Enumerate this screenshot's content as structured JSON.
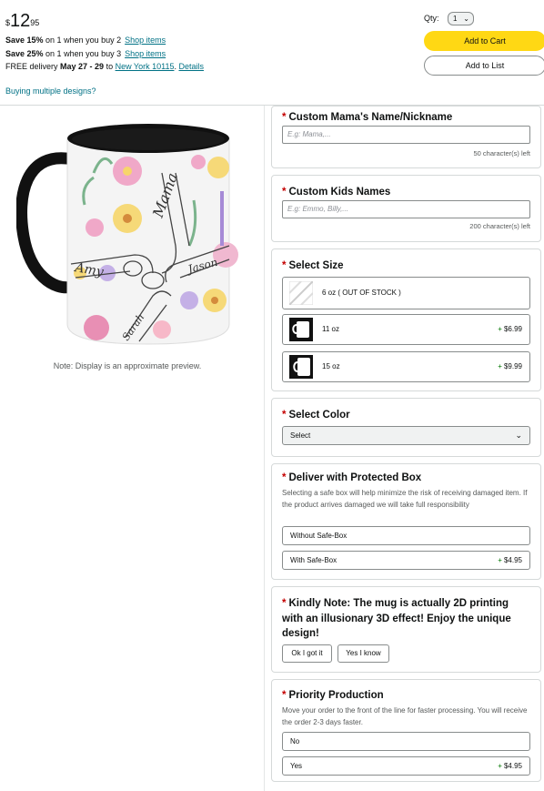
{
  "header": {
    "price_symbol": "$",
    "price_whole": "12",
    "price_fraction": "95",
    "offers": [
      {
        "bold": "Save 15%",
        "text": " on 1 when you buy 2",
        "link": "Shop items"
      },
      {
        "bold": "Save 25%",
        "text": " on 1 when you buy 3",
        "link": "Shop items"
      }
    ],
    "delivery": {
      "prefix": "FREE delivery ",
      "dates": "May 27 - 29",
      "to": " to ",
      "location": "New York 10115",
      "sep": ". ",
      "details": "Details"
    },
    "multi_link": "Buying multiple designs?",
    "qty_label": "Qty:",
    "qty_value": "1",
    "add_to_cart": "Add to Cart",
    "add_to_list": "Add to List"
  },
  "preview": {
    "names": [
      "Mama",
      "Amy",
      "Jason",
      "Sarah"
    ],
    "note": "Note: Display is an approximate preview."
  },
  "mama_name": {
    "title": "Custom Mama's Name/Nickname",
    "placeholder": "E.g: Mama,...",
    "counter": "50 character(s) left"
  },
  "kids_names": {
    "title": "Custom Kids Names",
    "placeholder": "E.g: Emmo, Billy,...",
    "counter": "200 character(s) left"
  },
  "size": {
    "title": "Select Size",
    "options": [
      {
        "label": "6 oz ( OUT OF STOCK )",
        "price": ""
      },
      {
        "label": "11 oz",
        "price": "$6.99"
      },
      {
        "label": "15 oz",
        "price": "$9.99"
      }
    ]
  },
  "color": {
    "title": "Select Color",
    "selected": "Select"
  },
  "protected_box": {
    "title": "Deliver with Protected Box",
    "description": "Selecting a safe box will help minimize the risk of receiving damaged item. If the product arrives damaged we will take full responsibility",
    "options": [
      {
        "label": "Without Safe-Box",
        "price": ""
      },
      {
        "label": "With Safe-Box",
        "price": "$4.95"
      }
    ]
  },
  "kindly_note": {
    "title": "Kindly Note: The mug is actually 2D printing with an illusionary 3D effect! Enjoy the unique design!",
    "buttons": [
      "Ok I got it",
      "Yes I know"
    ]
  },
  "priority": {
    "title": "Priority Production",
    "description": "Move your order to the front of the line for faster processing. You will receive the order 2-3 days faster.",
    "options": [
      {
        "label": "No",
        "price": ""
      },
      {
        "label": "Yes",
        "price": "$4.95"
      }
    ]
  },
  "plus_sign": "+",
  "required_mark": "*",
  "colors": {
    "cart": "#ffd814",
    "link": "#007185",
    "required": "#c40000",
    "plus": "#007600"
  }
}
